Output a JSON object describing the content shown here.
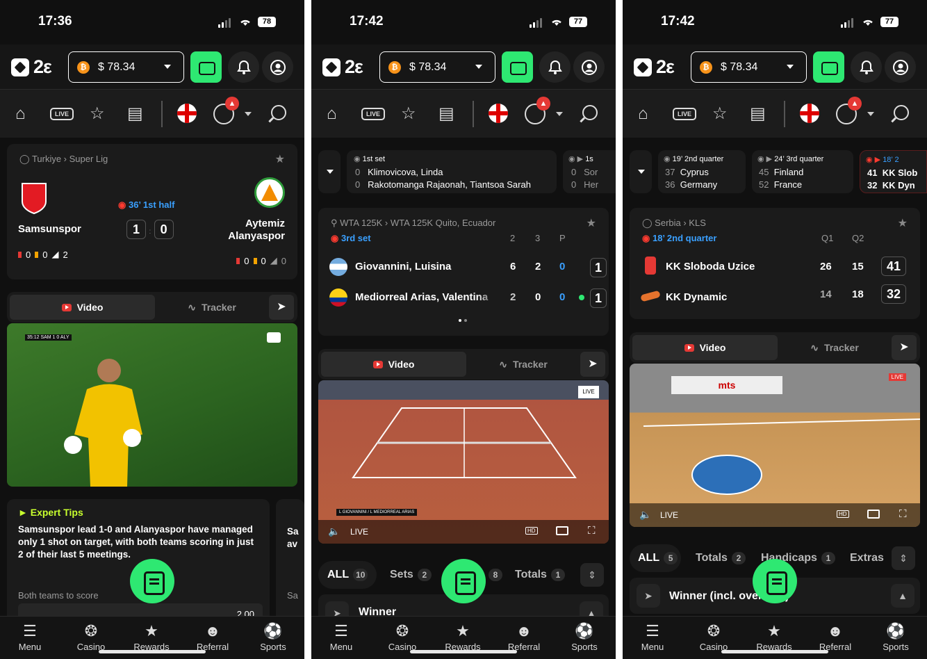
{
  "common": {
    "logo_text": "2ε",
    "balance": "$ 78.34",
    "coin": "₿",
    "live_badge": "LIVE",
    "bottom": [
      {
        "label": "Menu",
        "icon": "☰"
      },
      {
        "label": "Casino",
        "icon": "❂"
      },
      {
        "label": "Rewards",
        "icon": "★"
      },
      {
        "label": "Referral",
        "icon": "☻"
      },
      {
        "label": "Sports",
        "icon": "⚽"
      }
    ],
    "video_tab": "Video",
    "tracker_tab": "Tracker"
  },
  "p1": {
    "time": "17:36",
    "battery": "78",
    "league": "Turkiye › Super Lig",
    "home": "Samsunspor",
    "away_line1": "Aytemiz",
    "away_line2": "Alanyaspor",
    "status": "36’ 1st half",
    "home_score": "1",
    "away_score": "0",
    "home_stats": [
      "0",
      "0",
      "2"
    ],
    "away_stats": [
      "0",
      "0",
      "0"
    ],
    "video_overlay": "35:12 SAM 1 0 ALY",
    "tips_title": "Expert Tips",
    "tips_text": "Samsunspor lead 1-0 and Alanyaspor have managed only 1 shot on target, with both teams scoring in just 2 of their last 5 meetings.",
    "tips_label": "Both teams to score",
    "tips_odds": "2.00",
    "tips_side_a": "Sa",
    "tips_side_b": "av",
    "tips_side_c": "Sa"
  },
  "p2": {
    "time": "17:42",
    "battery": "77",
    "ticker": {
      "period": "1st set",
      "p1": "Klimovicova, Linda",
      "p2": "Rakotomanga Rajaonah, Tiantsoa Sarah",
      "s1": "0",
      "s2": "0",
      "next1": "Sor",
      "next2": "Her",
      "next_period": "1s"
    },
    "league": "WTA 125K › WTA 125K Quito, Ecuador",
    "status": "3rd set",
    "cols": [
      "2",
      "3",
      "P"
    ],
    "players": [
      {
        "name": "Giovannini, Luisina",
        "scores": [
          "6",
          "2",
          "0"
        ],
        "total": "1"
      },
      {
        "name": "Mediorreal Arias, Valentina",
        "scores": [
          "2",
          "0",
          "0"
        ],
        "total": "1"
      }
    ],
    "markets": {
      "all": "ALL",
      "all_n": "10",
      "sets": "Sets",
      "sets_n": "2",
      "other_n": "8",
      "totals": "Totals",
      "totals_n": "1"
    },
    "winner": "Winner",
    "video_score": "L GIOVANNINI / L MEDIORREAL ARIAS"
  },
  "p3": {
    "time": "17:42",
    "battery": "77",
    "tickers": [
      {
        "period": "19’ 2nd quarter",
        "a": "Cyprus",
        "b": "Germany",
        "sa": "37",
        "sb": "36"
      },
      {
        "period": "24’ 3rd quarter",
        "a": "Finland",
        "b": "France",
        "sa": "45",
        "sb": "52"
      },
      {
        "period": "18’ 2",
        "a": "KK Slob",
        "b": "KK Dyn",
        "sa": "41",
        "sb": "32"
      }
    ],
    "league": "Serbia › KLS",
    "status": "18’ 2nd quarter",
    "cols": [
      "Q1",
      "Q2"
    ],
    "teams": [
      {
        "name": "KK Sloboda Uzice",
        "q": [
          "26",
          "15"
        ],
        "total": "41"
      },
      {
        "name": "KK Dynamic",
        "q": [
          "14",
          "18"
        ],
        "total": "32"
      }
    ],
    "markets": {
      "all": "ALL",
      "all_n": "5",
      "totals": "Totals",
      "totals_n": "2",
      "handicaps": "Handicaps",
      "handicaps_n": "1",
      "extras": "Extras"
    },
    "winner": "Winner (incl. overtime)",
    "video_brand": "mts"
  }
}
